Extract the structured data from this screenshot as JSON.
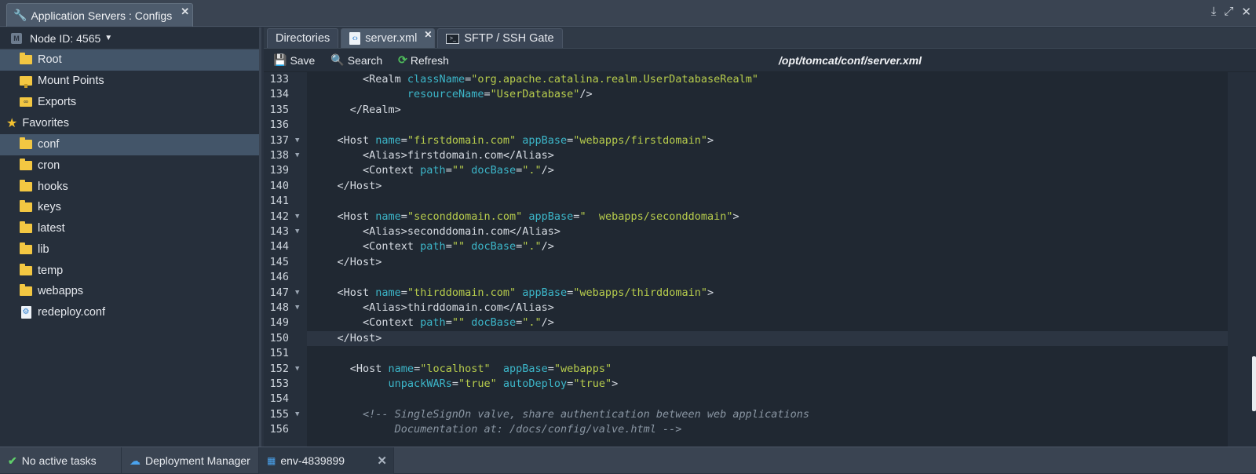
{
  "window": {
    "title": "Application Servers : Configs",
    "close": "✕",
    "controls": [
      "⤓",
      "⤢",
      "✕"
    ]
  },
  "sidebar": {
    "node_label": "Node ID: 4565",
    "node_badge": "M",
    "top_items": [
      {
        "label": "Root",
        "icon": "folder-icon",
        "selected": true
      },
      {
        "label": "Mount Points",
        "icon": "mount-icon"
      },
      {
        "label": "Exports",
        "icon": "exports-icon"
      }
    ],
    "favorites_label": "Favorites",
    "favorites": [
      {
        "label": "conf",
        "icon": "folder-icon",
        "selected": true
      },
      {
        "label": "cron",
        "icon": "folder-icon"
      },
      {
        "label": "hooks",
        "icon": "folder-icon"
      },
      {
        "label": "keys",
        "icon": "folder-icon"
      },
      {
        "label": "latest",
        "icon": "folder-icon"
      },
      {
        "label": "lib",
        "icon": "folder-icon"
      },
      {
        "label": "temp",
        "icon": "folder-icon"
      },
      {
        "label": "webapps",
        "icon": "folder-icon"
      },
      {
        "label": "redeploy.conf",
        "icon": "config-file-icon"
      }
    ]
  },
  "tabs": [
    {
      "label": "Directories"
    },
    {
      "label": "server.xml",
      "active": true,
      "close": "✕"
    },
    {
      "label": "SFTP / SSH Gate"
    }
  ],
  "toolbar": {
    "save_label": "Save",
    "search_label": "Search",
    "refresh_label": "Refresh",
    "file_path": "/opt/tomcat/conf/server.xml"
  },
  "editor": {
    "current_line": 150,
    "lines": [
      {
        "n": "133",
        "fold": false,
        "tokens": [
          [
            "t",
            "        <Realm "
          ],
          [
            "a",
            "className"
          ],
          [
            "t",
            "="
          ],
          [
            "v",
            "\"org.apache.catalina.realm.UserDatabaseRealm\""
          ]
        ]
      },
      {
        "n": "134",
        "fold": false,
        "tokens": [
          [
            "t",
            "               "
          ],
          [
            "a",
            "resourceName"
          ],
          [
            "t",
            "="
          ],
          [
            "v",
            "\"UserDatabase\""
          ],
          [
            "t",
            "/>"
          ]
        ]
      },
      {
        "n": "135",
        "fold": false,
        "tokens": [
          [
            "t",
            "      </Realm>"
          ]
        ]
      },
      {
        "n": "136",
        "fold": false,
        "tokens": []
      },
      {
        "n": "137",
        "fold": true,
        "tokens": [
          [
            "t",
            "    <Host "
          ],
          [
            "a",
            "name"
          ],
          [
            "t",
            "="
          ],
          [
            "v",
            "\"firstdomain.com\""
          ],
          [
            "t",
            " "
          ],
          [
            "a",
            "appBase"
          ],
          [
            "t",
            "="
          ],
          [
            "v",
            "\"webapps/firstdomain\""
          ],
          [
            "t",
            ">"
          ]
        ]
      },
      {
        "n": "138",
        "fold": true,
        "tokens": [
          [
            "t",
            "        <Alias>firstdomain.com</Alias>"
          ]
        ]
      },
      {
        "n": "139",
        "fold": false,
        "tokens": [
          [
            "t",
            "        <Context "
          ],
          [
            "a",
            "path"
          ],
          [
            "t",
            "="
          ],
          [
            "v",
            "\"\""
          ],
          [
            "t",
            " "
          ],
          [
            "a",
            "docBase"
          ],
          [
            "t",
            "="
          ],
          [
            "v",
            "\".\""
          ],
          [
            "t",
            "/>"
          ]
        ]
      },
      {
        "n": "140",
        "fold": false,
        "tokens": [
          [
            "t",
            "    </Host>"
          ]
        ]
      },
      {
        "n": "141",
        "fold": false,
        "tokens": []
      },
      {
        "n": "142",
        "fold": true,
        "tokens": [
          [
            "t",
            "    <Host "
          ],
          [
            "a",
            "name"
          ],
          [
            "t",
            "="
          ],
          [
            "v",
            "\"seconddomain.com\""
          ],
          [
            "t",
            " "
          ],
          [
            "a",
            "appBase"
          ],
          [
            "t",
            "="
          ],
          [
            "v",
            "\"  webapps/seconddomain\""
          ],
          [
            "t",
            ">"
          ]
        ]
      },
      {
        "n": "143",
        "fold": true,
        "tokens": [
          [
            "t",
            "        <Alias>seconddomain.com</Alias>"
          ]
        ]
      },
      {
        "n": "144",
        "fold": false,
        "tokens": [
          [
            "t",
            "        <Context "
          ],
          [
            "a",
            "path"
          ],
          [
            "t",
            "="
          ],
          [
            "v",
            "\"\""
          ],
          [
            "t",
            " "
          ],
          [
            "a",
            "docBase"
          ],
          [
            "t",
            "="
          ],
          [
            "v",
            "\".\""
          ],
          [
            "t",
            "/>"
          ]
        ]
      },
      {
        "n": "145",
        "fold": false,
        "tokens": [
          [
            "t",
            "    </Host>"
          ]
        ]
      },
      {
        "n": "146",
        "fold": false,
        "tokens": []
      },
      {
        "n": "147",
        "fold": true,
        "tokens": [
          [
            "t",
            "    <Host "
          ],
          [
            "a",
            "name"
          ],
          [
            "t",
            "="
          ],
          [
            "v",
            "\"thirddomain.com\""
          ],
          [
            "t",
            " "
          ],
          [
            "a",
            "appBase"
          ],
          [
            "t",
            "="
          ],
          [
            "v",
            "\"webapps/thirddomain\""
          ],
          [
            "t",
            ">"
          ]
        ]
      },
      {
        "n": "148",
        "fold": true,
        "tokens": [
          [
            "t",
            "        <Alias>thirddomain.com</Alias>"
          ]
        ]
      },
      {
        "n": "149",
        "fold": false,
        "tokens": [
          [
            "t",
            "        <Context "
          ],
          [
            "a",
            "path"
          ],
          [
            "t",
            "="
          ],
          [
            "v",
            "\"\""
          ],
          [
            "t",
            " "
          ],
          [
            "a",
            "docBase"
          ],
          [
            "t",
            "="
          ],
          [
            "v",
            "\".\""
          ],
          [
            "t",
            "/>"
          ]
        ]
      },
      {
        "n": "150",
        "fold": false,
        "tokens": [
          [
            "t",
            "    </Host>"
          ]
        ]
      },
      {
        "n": "151",
        "fold": false,
        "tokens": []
      },
      {
        "n": "152",
        "fold": true,
        "tokens": [
          [
            "t",
            "      <Host "
          ],
          [
            "a",
            "name"
          ],
          [
            "t",
            "="
          ],
          [
            "v",
            "\"localhost\""
          ],
          [
            "t",
            "  "
          ],
          [
            "a",
            "appBase"
          ],
          [
            "t",
            "="
          ],
          [
            "v",
            "\"webapps\""
          ]
        ]
      },
      {
        "n": "153",
        "fold": false,
        "tokens": [
          [
            "t",
            "            "
          ],
          [
            "a",
            "unpackWARs"
          ],
          [
            "t",
            "="
          ],
          [
            "v",
            "\"true\""
          ],
          [
            "t",
            " "
          ],
          [
            "a",
            "autoDeploy"
          ],
          [
            "t",
            "="
          ],
          [
            "v",
            "\"true\""
          ],
          [
            "t",
            ">"
          ]
        ]
      },
      {
        "n": "154",
        "fold": false,
        "tokens": []
      },
      {
        "n": "155",
        "fold": true,
        "tokens": [
          [
            "c",
            "        <!-- SingleSignOn valve, share authentication between web applications"
          ]
        ]
      },
      {
        "n": "156",
        "fold": false,
        "tokens": [
          [
            "c",
            "             Documentation at: /docs/config/valve.html -->"
          ]
        ]
      }
    ]
  },
  "statusbar": {
    "tasks": "No active tasks",
    "deployment_manager": "Deployment Manager",
    "env": "env-4839899",
    "close": "✕"
  },
  "colors": {
    "accent": "#435569",
    "folder": "#f3c742",
    "attr": "#3cb6c9",
    "value": "#b7cc4c"
  }
}
